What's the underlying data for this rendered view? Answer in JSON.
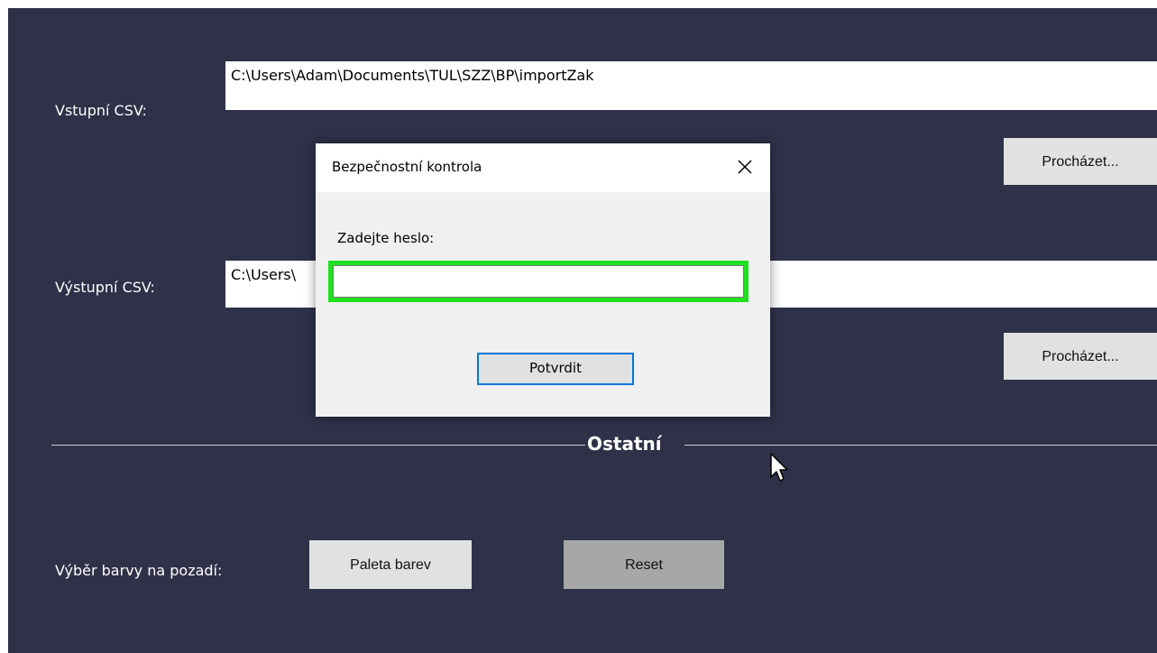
{
  "form": {
    "input_label": "Vstupní CSV:",
    "input_path": "C:\\Users\\Adam\\Documents\\TUL\\SZZ\\BP\\importZak",
    "browse_label_1": "Procházet...",
    "output_label": "Výstupní CSV:",
    "output_path": "C:\\Users\\",
    "browse_label_2": "Procházet...",
    "section_title": "Ostatní",
    "bg_color_label": "Výběr barvy na pozadí:",
    "palette_button": "Paleta barev",
    "reset_button": "Reset"
  },
  "dialog": {
    "title": "Bezpečnostní kontrola",
    "prompt": "Zadejte heslo:",
    "password_value": "",
    "confirm_button": "Potvrdit"
  },
  "icons": {
    "close": "close-icon",
    "cursor": "mouse-cursor-icon"
  },
  "colors": {
    "background": "#2f3149",
    "focus_highlight": "#20e020",
    "default_button_border": "#0078d7"
  }
}
